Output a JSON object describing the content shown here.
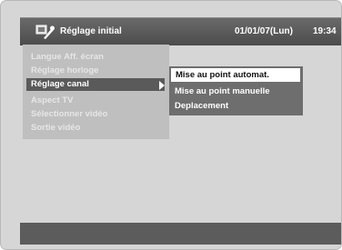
{
  "header": {
    "icon": "setup-tools-icon",
    "title": "Réglage initial",
    "date": "01/01/07(Lun)",
    "time": "19:34"
  },
  "menu": {
    "items": [
      {
        "label": "Langue Aff. écran"
      },
      {
        "label": "Réglage horloge"
      },
      {
        "label": "Réglage canal"
      },
      {
        "label": "Aspect TV"
      },
      {
        "label": "Sélectionner vidéo"
      },
      {
        "label": "Sortie vidéo"
      }
    ],
    "selected": "Réglage canal"
  },
  "submenu": {
    "items": [
      {
        "label": "Mise au point automat."
      },
      {
        "label": "Mise au point manuelle"
      },
      {
        "label": "Deplacement"
      }
    ],
    "highlighted": "Mise au point automat."
  },
  "colors": {
    "background": "#d6d6d6",
    "titlebar": "#555555",
    "selection": "#5a5a5a",
    "submenu_bg": "#6e6e6e"
  }
}
